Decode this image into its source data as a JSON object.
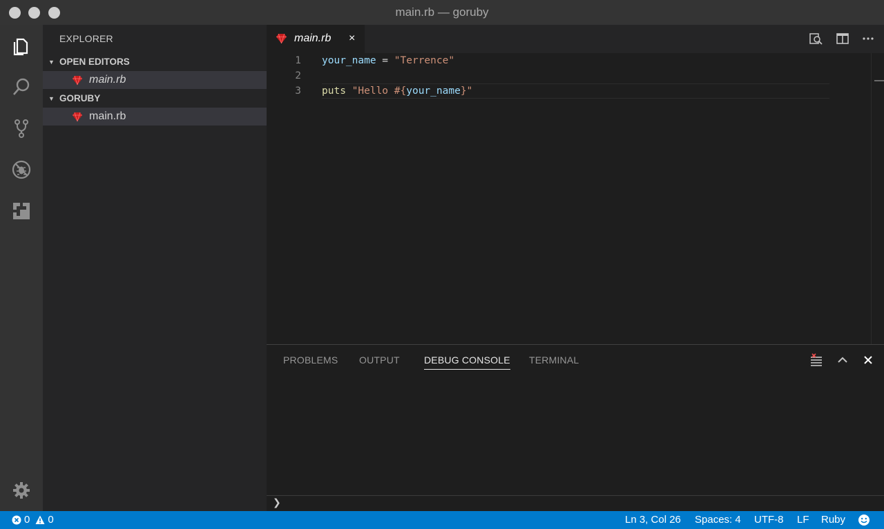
{
  "window": {
    "title": "main.rb — goruby"
  },
  "activity_bar": {
    "items": [
      {
        "name": "explorer-icon",
        "active": true
      },
      {
        "name": "search-icon"
      },
      {
        "name": "source-control-icon"
      },
      {
        "name": "debug-icon"
      },
      {
        "name": "extensions-icon"
      }
    ],
    "settings": "gear-icon"
  },
  "sidebar": {
    "title": "EXPLORER",
    "open_editors": {
      "label": "OPEN EDITORS",
      "files": [
        {
          "name": "main.rb"
        }
      ]
    },
    "folder": {
      "label": "GORUBY",
      "files": [
        {
          "name": "main.rb"
        }
      ]
    }
  },
  "editor": {
    "tab": {
      "label": "main.rb",
      "close": "×"
    },
    "lines": [
      {
        "number": "1"
      },
      {
        "number": "2"
      },
      {
        "number": "3"
      }
    ],
    "code": {
      "line1": {
        "var": "your_name",
        "op": " = ",
        "str": "\"Terrence\""
      },
      "line3": {
        "kw": "puts",
        "sp": " ",
        "str_a": "\"Hello #{",
        "interp": "your_name",
        "str_b": "}\""
      }
    }
  },
  "panel": {
    "tabs": [
      "PROBLEMS",
      "OUTPUT",
      "DEBUG CONSOLE",
      "TERMINAL"
    ],
    "active_tab": "DEBUG CONSOLE",
    "prompt": "❯"
  },
  "status_bar": {
    "errors": "0",
    "warnings": "0",
    "position": "Ln 3, Col 26",
    "spaces": "Spaces: 4",
    "encoding": "UTF-8",
    "eol": "LF",
    "language": "Ruby"
  },
  "colors": {
    "accent": "#007acc",
    "variable": "#9cdcfe",
    "string": "#ce9178",
    "keyword": "#dcdcaa"
  }
}
